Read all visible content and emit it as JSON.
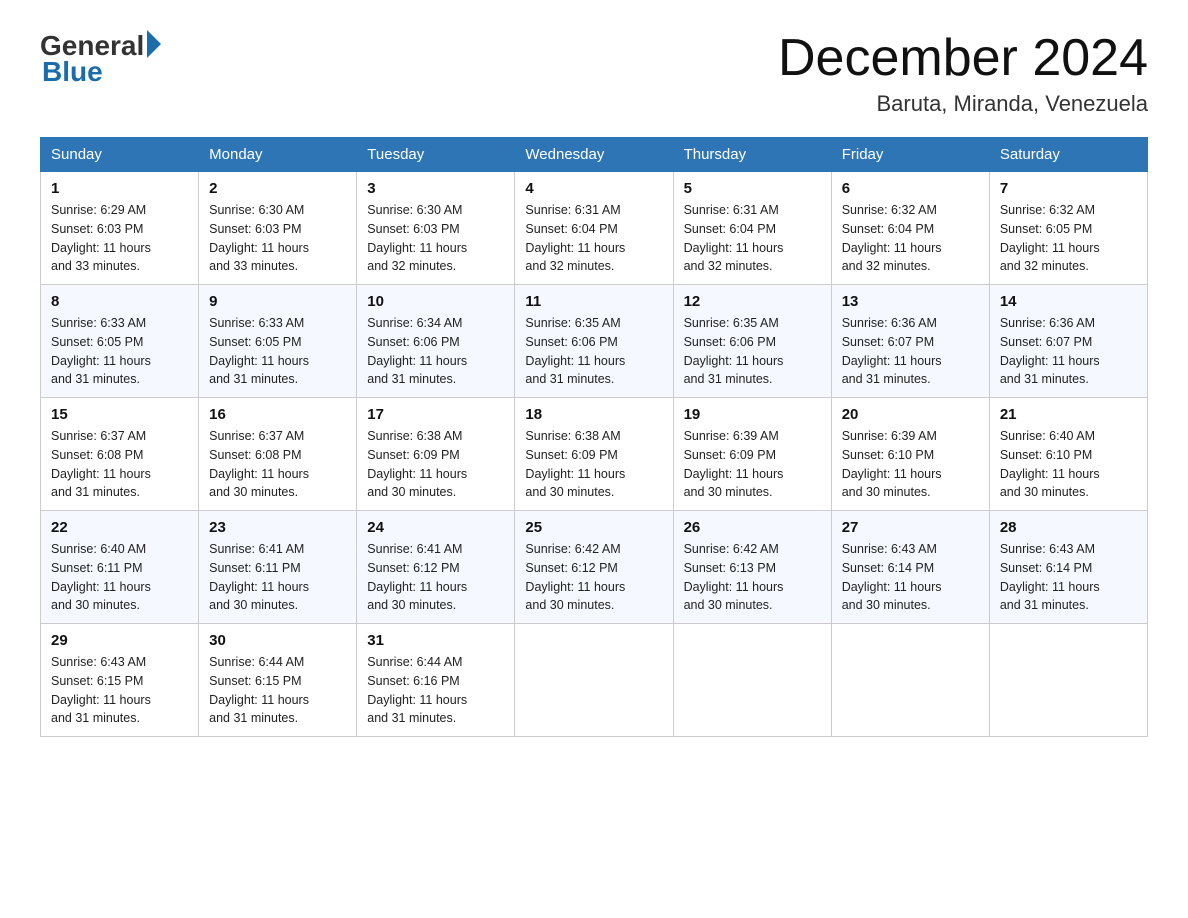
{
  "header": {
    "logo_general": "General",
    "logo_blue": "Blue",
    "month_title": "December 2024",
    "location": "Baruta, Miranda, Venezuela"
  },
  "days_of_week": [
    "Sunday",
    "Monday",
    "Tuesday",
    "Wednesday",
    "Thursday",
    "Friday",
    "Saturday"
  ],
  "weeks": [
    [
      {
        "day": "1",
        "sunrise": "6:29 AM",
        "sunset": "6:03 PM",
        "daylight": "11 hours and 33 minutes."
      },
      {
        "day": "2",
        "sunrise": "6:30 AM",
        "sunset": "6:03 PM",
        "daylight": "11 hours and 33 minutes."
      },
      {
        "day": "3",
        "sunrise": "6:30 AM",
        "sunset": "6:03 PM",
        "daylight": "11 hours and 32 minutes."
      },
      {
        "day": "4",
        "sunrise": "6:31 AM",
        "sunset": "6:04 PM",
        "daylight": "11 hours and 32 minutes."
      },
      {
        "day": "5",
        "sunrise": "6:31 AM",
        "sunset": "6:04 PM",
        "daylight": "11 hours and 32 minutes."
      },
      {
        "day": "6",
        "sunrise": "6:32 AM",
        "sunset": "6:04 PM",
        "daylight": "11 hours and 32 minutes."
      },
      {
        "day": "7",
        "sunrise": "6:32 AM",
        "sunset": "6:05 PM",
        "daylight": "11 hours and 32 minutes."
      }
    ],
    [
      {
        "day": "8",
        "sunrise": "6:33 AM",
        "sunset": "6:05 PM",
        "daylight": "11 hours and 31 minutes."
      },
      {
        "day": "9",
        "sunrise": "6:33 AM",
        "sunset": "6:05 PM",
        "daylight": "11 hours and 31 minutes."
      },
      {
        "day": "10",
        "sunrise": "6:34 AM",
        "sunset": "6:06 PM",
        "daylight": "11 hours and 31 minutes."
      },
      {
        "day": "11",
        "sunrise": "6:35 AM",
        "sunset": "6:06 PM",
        "daylight": "11 hours and 31 minutes."
      },
      {
        "day": "12",
        "sunrise": "6:35 AM",
        "sunset": "6:06 PM",
        "daylight": "11 hours and 31 minutes."
      },
      {
        "day": "13",
        "sunrise": "6:36 AM",
        "sunset": "6:07 PM",
        "daylight": "11 hours and 31 minutes."
      },
      {
        "day": "14",
        "sunrise": "6:36 AM",
        "sunset": "6:07 PM",
        "daylight": "11 hours and 31 minutes."
      }
    ],
    [
      {
        "day": "15",
        "sunrise": "6:37 AM",
        "sunset": "6:08 PM",
        "daylight": "11 hours and 31 minutes."
      },
      {
        "day": "16",
        "sunrise": "6:37 AM",
        "sunset": "6:08 PM",
        "daylight": "11 hours and 30 minutes."
      },
      {
        "day": "17",
        "sunrise": "6:38 AM",
        "sunset": "6:09 PM",
        "daylight": "11 hours and 30 minutes."
      },
      {
        "day": "18",
        "sunrise": "6:38 AM",
        "sunset": "6:09 PM",
        "daylight": "11 hours and 30 minutes."
      },
      {
        "day": "19",
        "sunrise": "6:39 AM",
        "sunset": "6:09 PM",
        "daylight": "11 hours and 30 minutes."
      },
      {
        "day": "20",
        "sunrise": "6:39 AM",
        "sunset": "6:10 PM",
        "daylight": "11 hours and 30 minutes."
      },
      {
        "day": "21",
        "sunrise": "6:40 AM",
        "sunset": "6:10 PM",
        "daylight": "11 hours and 30 minutes."
      }
    ],
    [
      {
        "day": "22",
        "sunrise": "6:40 AM",
        "sunset": "6:11 PM",
        "daylight": "11 hours and 30 minutes."
      },
      {
        "day": "23",
        "sunrise": "6:41 AM",
        "sunset": "6:11 PM",
        "daylight": "11 hours and 30 minutes."
      },
      {
        "day": "24",
        "sunrise": "6:41 AM",
        "sunset": "6:12 PM",
        "daylight": "11 hours and 30 minutes."
      },
      {
        "day": "25",
        "sunrise": "6:42 AM",
        "sunset": "6:12 PM",
        "daylight": "11 hours and 30 minutes."
      },
      {
        "day": "26",
        "sunrise": "6:42 AM",
        "sunset": "6:13 PM",
        "daylight": "11 hours and 30 minutes."
      },
      {
        "day": "27",
        "sunrise": "6:43 AM",
        "sunset": "6:14 PM",
        "daylight": "11 hours and 30 minutes."
      },
      {
        "day": "28",
        "sunrise": "6:43 AM",
        "sunset": "6:14 PM",
        "daylight": "11 hours and 31 minutes."
      }
    ],
    [
      {
        "day": "29",
        "sunrise": "6:43 AM",
        "sunset": "6:15 PM",
        "daylight": "11 hours and 31 minutes."
      },
      {
        "day": "30",
        "sunrise": "6:44 AM",
        "sunset": "6:15 PM",
        "daylight": "11 hours and 31 minutes."
      },
      {
        "day": "31",
        "sunrise": "6:44 AM",
        "sunset": "6:16 PM",
        "daylight": "11 hours and 31 minutes."
      },
      null,
      null,
      null,
      null
    ]
  ],
  "labels": {
    "sunrise": "Sunrise:",
    "sunset": "Sunset:",
    "daylight": "Daylight:"
  }
}
